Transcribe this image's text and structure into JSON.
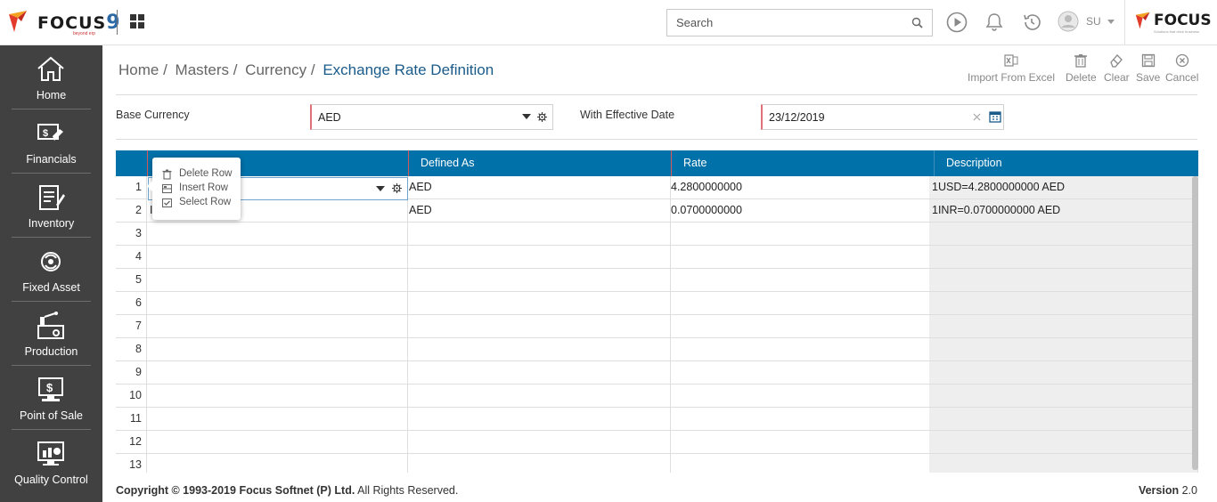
{
  "app": {
    "logo_text": "FOCUS",
    "logo_num": "9",
    "logo_sub": "beyond erp",
    "brand_text": "FOCUS",
    "brand_sub": "Solutions that drive business"
  },
  "header": {
    "search_placeholder": "Search",
    "user_name": "SU"
  },
  "sidebar": {
    "items": [
      {
        "label": "Home",
        "icon": "home-icon"
      },
      {
        "label": "Financials",
        "icon": "financials-icon"
      },
      {
        "label": "Inventory",
        "icon": "inventory-icon"
      },
      {
        "label": "Fixed Asset",
        "icon": "fixed-asset-icon"
      },
      {
        "label": "Production",
        "icon": "production-icon"
      },
      {
        "label": "Point of Sale",
        "icon": "point-of-sale-icon"
      },
      {
        "label": "Quality Control",
        "icon": "quality-control-icon"
      }
    ]
  },
  "breadcrumb": {
    "items": [
      "Home /",
      "Masters /",
      "Currency /"
    ],
    "current": "Exchange Rate Definition"
  },
  "toolbar": {
    "import_label": "Import From Excel",
    "delete_label": "Delete",
    "clear_label": "Clear",
    "save_label": "Save",
    "cancel_label": "Cancel"
  },
  "form": {
    "base_currency_label": "Base Currency",
    "base_currency_value": "AED",
    "effective_date_label": "With Effective Date",
    "effective_date_value": "23/12/2019"
  },
  "grid": {
    "columns": [
      "",
      "Defined As",
      "Rate",
      "Description"
    ],
    "rows": [
      {
        "num": "1",
        "currency": "",
        "defined_as": "AED",
        "rate": "4.2800000000",
        "description": "1USD=4.2800000000 AED"
      },
      {
        "num": "2",
        "currency": "I",
        "defined_as": "AED",
        "rate": "0.0700000000",
        "description": "1INR=0.0700000000 AED"
      },
      {
        "num": "3",
        "currency": "",
        "defined_as": "",
        "rate": "",
        "description": ""
      },
      {
        "num": "4",
        "currency": "",
        "defined_as": "",
        "rate": "",
        "description": ""
      },
      {
        "num": "5",
        "currency": "",
        "defined_as": "",
        "rate": "",
        "description": ""
      },
      {
        "num": "6",
        "currency": "",
        "defined_as": "",
        "rate": "",
        "description": ""
      },
      {
        "num": "7",
        "currency": "",
        "defined_as": "",
        "rate": "",
        "description": ""
      },
      {
        "num": "8",
        "currency": "",
        "defined_as": "",
        "rate": "",
        "description": ""
      },
      {
        "num": "9",
        "currency": "",
        "defined_as": "",
        "rate": "",
        "description": ""
      },
      {
        "num": "10",
        "currency": "",
        "defined_as": "",
        "rate": "",
        "description": ""
      },
      {
        "num": "11",
        "currency": "",
        "defined_as": "",
        "rate": "",
        "description": ""
      },
      {
        "num": "12",
        "currency": "",
        "defined_as": "",
        "rate": "",
        "description": ""
      },
      {
        "num": "13",
        "currency": "",
        "defined_as": "",
        "rate": "",
        "description": ""
      }
    ]
  },
  "context_menu": {
    "delete_row": "Delete Row",
    "insert_row": "Insert Row",
    "select_row": "Select Row"
  },
  "footer": {
    "copyright_prefix": "Copyright © 1993-2019",
    "copyright_company": "Focus Softnet (P) Ltd.",
    "copyright_suffix": "All Rights Reserved.",
    "version_label": "Version",
    "version_value": "2.0"
  },
  "colors": {
    "grid_header": "#0071a9",
    "sidebar": "#414141",
    "accent": "#1a5b8a",
    "required_marker": "#e0707a"
  }
}
